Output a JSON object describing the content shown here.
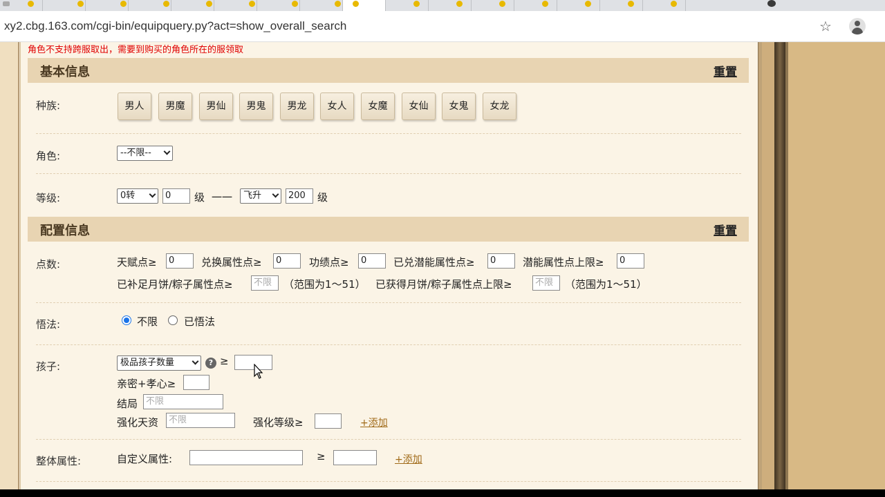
{
  "browser": {
    "url": "xy2.cbg.163.com/cgi-bin/equipquery.py?act=show_overall_search",
    "icons": [
      "star-icon",
      "account-icon"
    ]
  },
  "page": {
    "warning": "角色不支持跨服取出，需要到购买的角色所在的服领取",
    "basic_section": {
      "title": "基本信息",
      "reset": "重置",
      "race_label": "种族:",
      "races": [
        "男人",
        "男魔",
        "男仙",
        "男鬼",
        "男龙",
        "女人",
        "女魔",
        "女仙",
        "女鬼",
        "女龙"
      ],
      "role_label": "角色:",
      "role_select": "--不限--",
      "level_label": "等级:",
      "level_from_select": "0转",
      "level_from_value": "0",
      "level_unit": "级",
      "level_dash": "一一",
      "level_to_select": "飞升",
      "level_to_value": "200",
      "level_unit2": "级"
    },
    "config_section": {
      "title": "配置信息",
      "reset": "重置",
      "points_label": "点数:",
      "talent_label": "天赋点≥",
      "talent_value": "0",
      "exchange_label": "兑换属性点≥",
      "exchange_value": "0",
      "merit_label": "功绩点≥",
      "merit_value": "0",
      "potential_label": "已兑潜能属性点≥",
      "potential_value": "0",
      "potential_cap_label": "潜能属性点上限≥",
      "potential_cap_value": "0",
      "mooncake_label": "已补足月饼/粽子属性点≥",
      "mooncake_placeholder": "不限",
      "mooncake_range": "（范围为1～51）",
      "mooncake_cap_label": "已获得月饼/粽子属性点上限≥",
      "mooncake_cap_placeholder": "不限",
      "mooncake_cap_range": "（范围为1～51）",
      "enlight_label": "悟法:",
      "enlight_opt1": "不限",
      "enlight_opt2": "已悟法",
      "enlight_selected": "不限",
      "child_label": "孩子:",
      "child_select": "极品孩子数量",
      "child_geq": "≥",
      "intimacy_label": "亲密+孝心≥",
      "ending_label": "结局",
      "ending_placeholder": "不限",
      "strength_talent_label": "强化天资",
      "strength_talent_placeholder": "不限",
      "strength_level_label": "强化等级≥",
      "add_link": "+添加",
      "overall_label": "整体属性:",
      "custom_attr_label": "自定义属性:",
      "overall_geq": "≥",
      "overall_add_link": "+添加"
    }
  },
  "colors": {
    "warning": "#e00000",
    "header_bg": "#e8d4b2",
    "content_bg": "#fbf4e6",
    "link": "#a06a18",
    "radio_accent": "#1a73e8"
  }
}
